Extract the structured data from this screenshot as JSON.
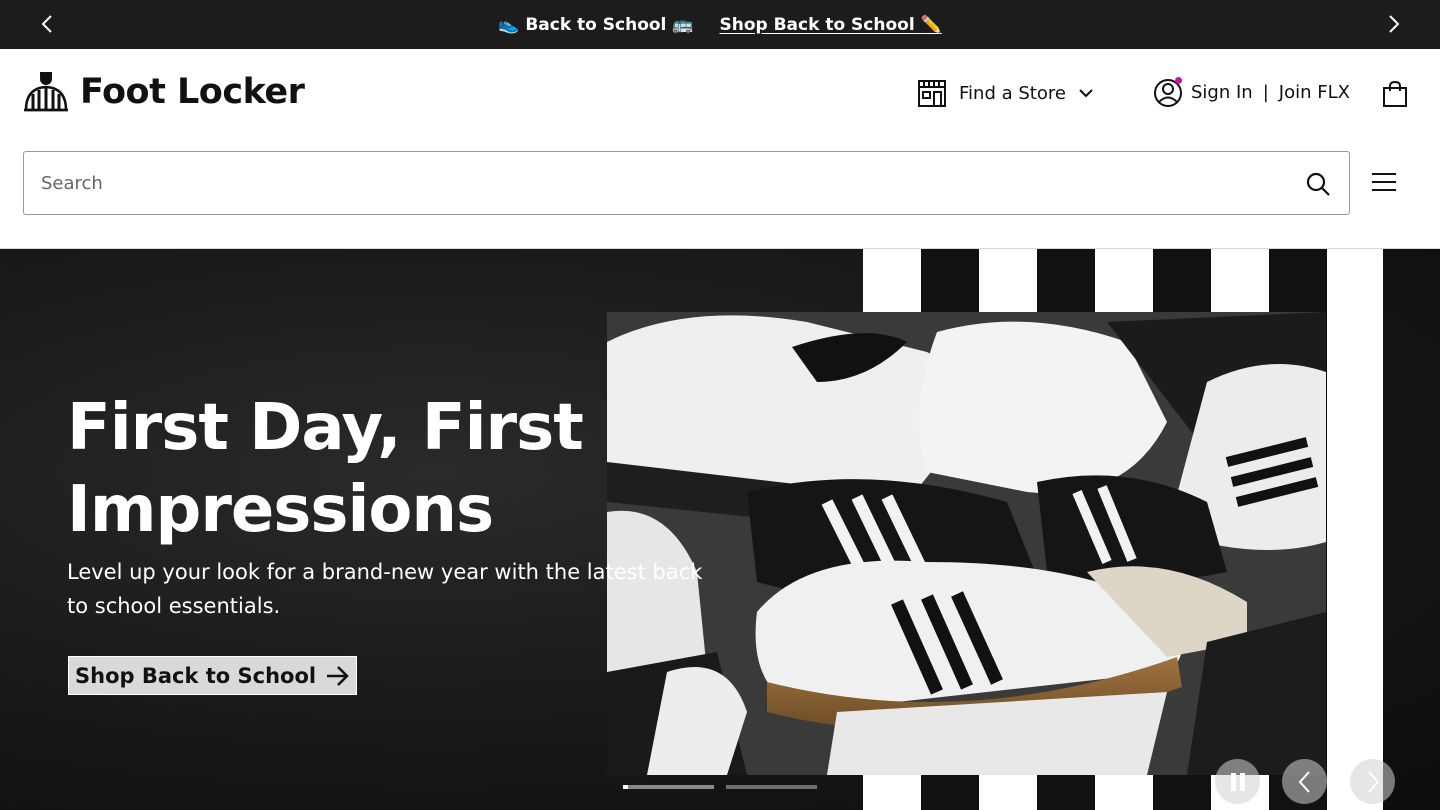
{
  "promo": {
    "message_text": "Back to School",
    "link_text": "Shop Back to School",
    "emoji_left": "👟",
    "emoji_bus": "🚌",
    "emoji_pencil": "✏️"
  },
  "header": {
    "logo_text": "Foot Locker",
    "find_store": "Find a Store",
    "sign_in": "Sign In",
    "separator": "|",
    "join": "Join FLX"
  },
  "search": {
    "placeholder": "Search"
  },
  "hero": {
    "title": "First Day, First Impressions",
    "subtitle": "Level up your look for a brand-new year with the latest back to school essentials.",
    "cta_label": "Shop Back to School",
    "slide_count": 2,
    "active_slide": 1
  },
  "colors": {
    "promo_bg": "#1c1c1c",
    "notification_dot": "#d0129a",
    "hero_bg": "#161616"
  },
  "icons": [
    "chevron-left-icon",
    "chevron-right-icon",
    "store-icon",
    "chevron-down-icon",
    "user-icon",
    "bag-icon",
    "search-icon",
    "menu-icon",
    "arrow-right-icon",
    "pause-icon"
  ]
}
